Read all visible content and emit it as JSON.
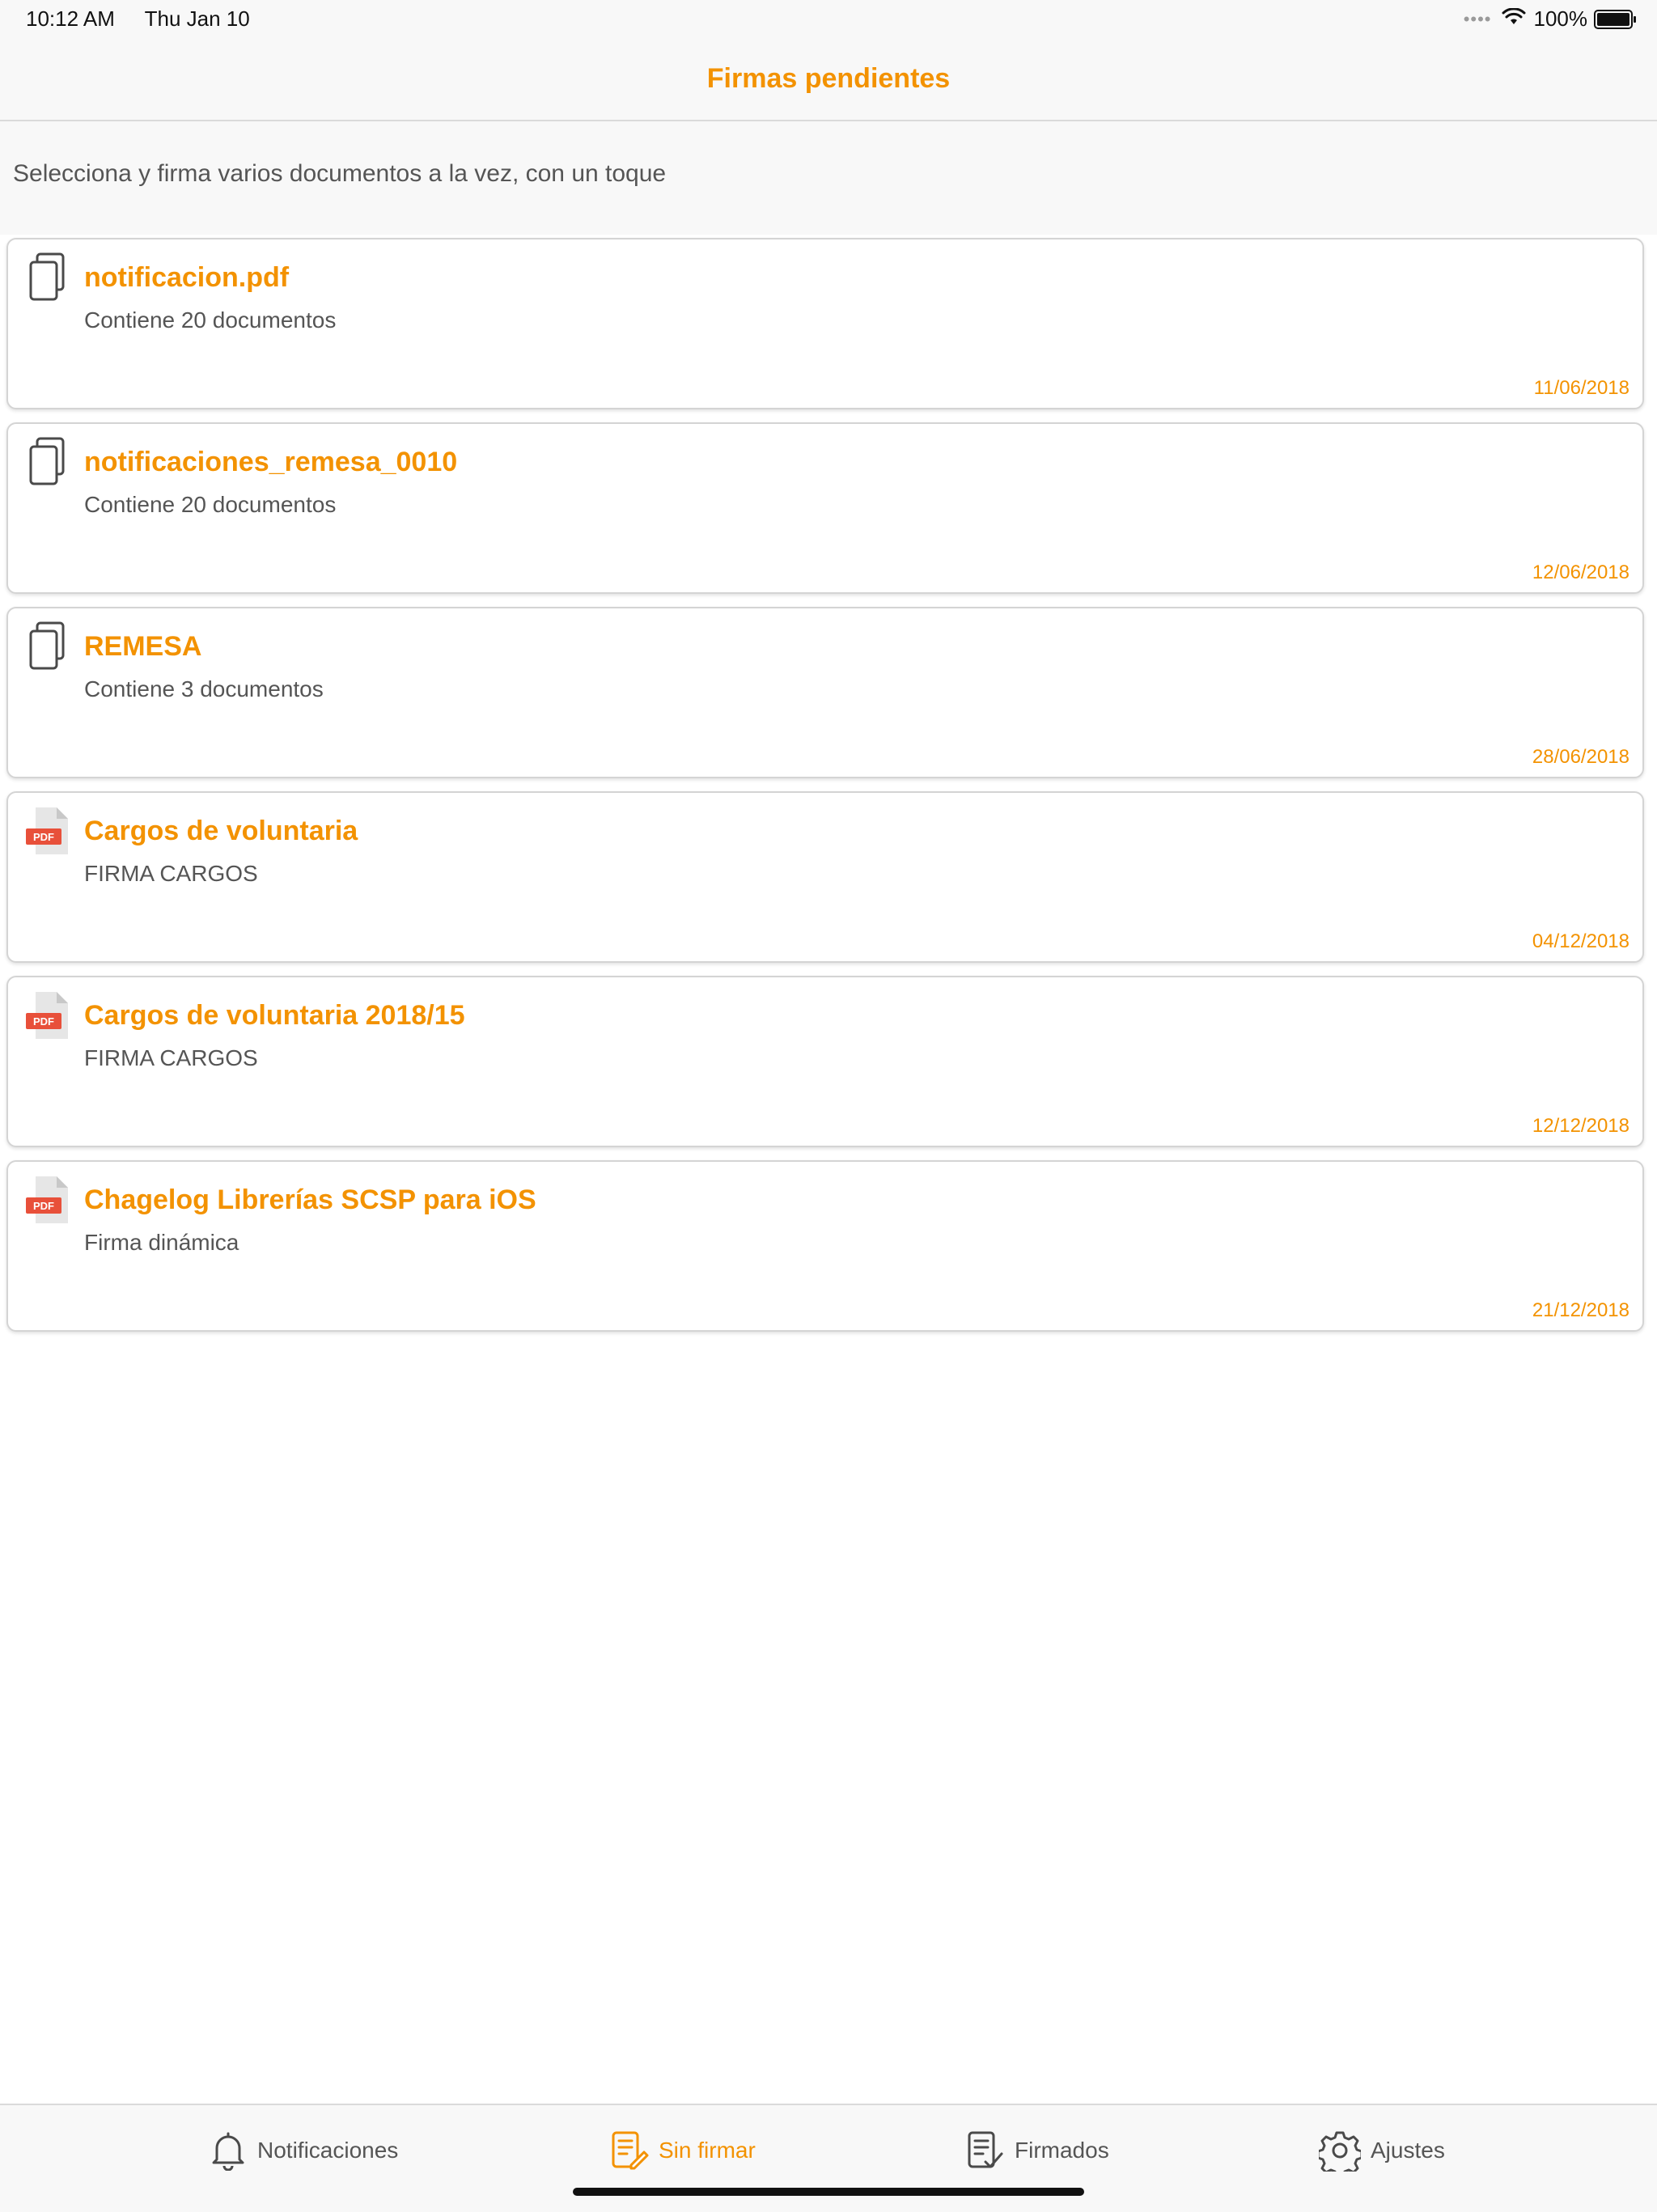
{
  "status_bar": {
    "time": "10:12 AM",
    "date": "Thu Jan 10",
    "battery": "100%"
  },
  "header": {
    "title": "Firmas pendientes"
  },
  "subtitle": "Selecciona y firma varios documentos a la vez, con un toque",
  "items": [
    {
      "icon": "documents-icon",
      "title": "notificacion.pdf",
      "description": "Contiene 20 documentos",
      "date": "11/06/2018"
    },
    {
      "icon": "documents-icon",
      "title": "notificaciones_remesa_0010",
      "description": "Contiene 20 documentos",
      "date": "12/06/2018"
    },
    {
      "icon": "documents-icon",
      "title": "REMESA",
      "description": "Contiene 3 documentos",
      "date": "28/06/2018"
    },
    {
      "icon": "pdf-icon",
      "title": "Cargos de voluntaria",
      "description": "FIRMA CARGOS",
      "date": "04/12/2018"
    },
    {
      "icon": "pdf-icon",
      "title": "Cargos de voluntaria 2018/15",
      "description": "FIRMA CARGOS",
      "date": "12/12/2018"
    },
    {
      "icon": "pdf-icon",
      "title": "Chagelog Librerías SCSP para iOS",
      "description": "Firma dinámica",
      "date": "21/12/2018"
    }
  ],
  "tab_bar": {
    "tabs": [
      {
        "label": "Notificaciones",
        "icon": "bell-icon",
        "active": false
      },
      {
        "label": "Sin firmar",
        "icon": "document-edit-icon",
        "active": true
      },
      {
        "label": "Firmados",
        "icon": "document-check-icon",
        "active": false
      },
      {
        "label": "Ajustes",
        "icon": "gear-icon",
        "active": false
      }
    ]
  },
  "colors": {
    "accent": "#f39200",
    "pdf_badge": "#e8503a",
    "text": "#555555"
  }
}
